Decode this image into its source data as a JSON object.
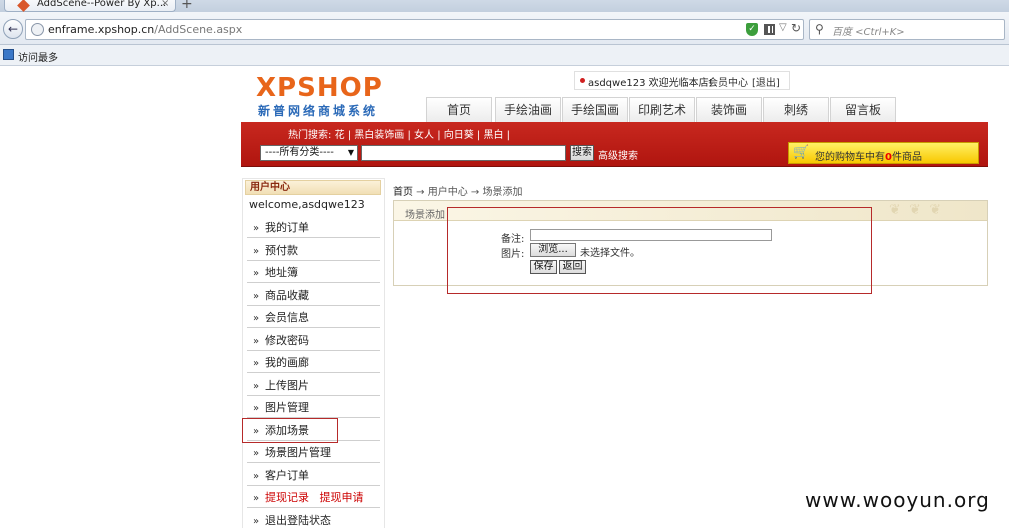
{
  "browser": {
    "tab_title": "AddScene--Power By Xp...",
    "tab_close": "×",
    "new_tab": "+",
    "url_host": "enframe.xpshop.cn",
    "url_path": "/AddScene.aspx",
    "url_prefix": "",
    "search_placeholder": "百度 <Ctrl+K>",
    "bookmark_label": "访问最多"
  },
  "site": {
    "logo": "XPSHOP",
    "slogan": "新普网络商城系统",
    "user_text": "asdqwe123 欢迎光临本店!",
    "member_center": "会员中心",
    "logout": "[退出]",
    "nav": [
      "首页",
      "手绘油画",
      "手绘国画",
      "印刷艺术",
      "装饰画",
      "刺绣",
      "留言板"
    ],
    "hot_label": "热门搜索:",
    "hot_items": "花 | 黑白装饰画 | 女人 | 向日葵 | 黑白 |",
    "category": "----所有分类----",
    "search_button": "搜索",
    "advanced_search": "高级搜索",
    "cart_prefix": "您的购物车中有",
    "cart_count": "0",
    "cart_suffix": "件商品"
  },
  "sidebar": {
    "title": "用户中心",
    "welcome": "welcome,asdqwe123",
    "items": [
      {
        "label": "我的订单"
      },
      {
        "label": "预付款"
      },
      {
        "label": "地址簿"
      },
      {
        "label": "商品收藏"
      },
      {
        "label": "会员信息"
      },
      {
        "label": "修改密码"
      },
      {
        "label": "我的画廊"
      },
      {
        "label": "上传图片"
      },
      {
        "label": "图片管理"
      },
      {
        "label": "添加场景"
      },
      {
        "label": "场景图片管理"
      },
      {
        "label": "客户订单"
      },
      {
        "label": "提现记录",
        "label2": "提现申请"
      },
      {
        "label": "退出登陆状态"
      }
    ]
  },
  "content": {
    "breadcrumb_home": "首页",
    "breadcrumb_rest": " → 用户中心 → 场景添加",
    "panel_title": "场景添加",
    "note_label": "备注:",
    "image_label": "图片:",
    "browse_button": "浏览...",
    "no_file": "未选择文件。",
    "save_button": "保存",
    "back_button": "返回"
  },
  "watermark": "www.wooyun.org"
}
